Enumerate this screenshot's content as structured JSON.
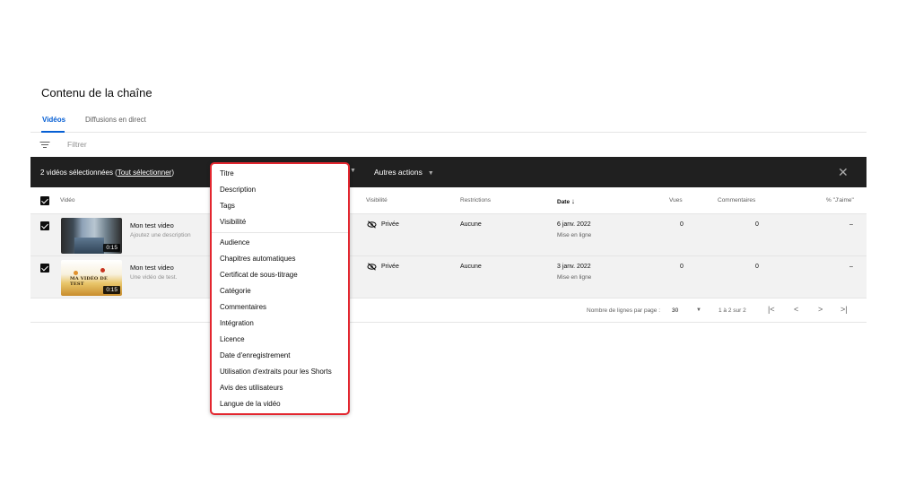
{
  "page": {
    "title": "Contenu de la chaîne"
  },
  "tabs": [
    {
      "label": "Vidéos",
      "active": true
    },
    {
      "label": "Diffusions en direct",
      "active": false
    }
  ],
  "filter": {
    "placeholder": "Filtrer",
    "icon": "filter-icon"
  },
  "action_bar": {
    "selection_prefix": "2 vidéos sélectionnées (",
    "select_all": "Tout sélectionner",
    "selection_suffix": ")",
    "more_actions": "Autres actions",
    "close_icon": "close-icon"
  },
  "table": {
    "headers": {
      "video": "Vidéo",
      "visibility": "Visibilité",
      "restrictions": "Restrictions",
      "date": "Date",
      "views": "Vues",
      "comments": "Commentaires",
      "likes": "% \"J'aime\""
    },
    "rows": [
      {
        "title": "Mon test video",
        "description": "Ajoutez une description",
        "duration": "0:15",
        "visibility": "Privée",
        "restrictions": "Aucune",
        "date": "6 janv. 2022",
        "date_status": "Mise en ligne",
        "views": "0",
        "comments": "0",
        "likes": "–"
      },
      {
        "title": "Mon test video",
        "description": "Une vidéo de test.",
        "duration": "0:15",
        "thumbnail_text": "MA VIDÉO DE TEST",
        "visibility": "Privée",
        "restrictions": "Aucune",
        "date": "3 janv. 2022",
        "date_status": "Mise en ligne",
        "views": "0",
        "comments": "0",
        "likes": "–"
      }
    ]
  },
  "pagination": {
    "rows_per_page_label": "Nombre de lignes par page :",
    "rows_per_page": "30",
    "range": "1 à 2 sur 2"
  },
  "edit_menu": {
    "items": [
      "Titre",
      "Description",
      "Tags",
      "Visibilité",
      "Audience",
      "Chapitres automatiques",
      "Certificat de sous-titrage",
      "Catégorie",
      "Commentaires",
      "Intégration",
      "Licence",
      "Date d'enregistrement",
      "Utilisation d'extraits pour les Shorts",
      "Avis des utilisateurs",
      "Langue de la vidéo"
    ],
    "highlight_color": "#e3262f"
  },
  "colors": {
    "accent": "#065fd4",
    "action_bar": "#202020",
    "row_selected": "#f2f2f2"
  }
}
